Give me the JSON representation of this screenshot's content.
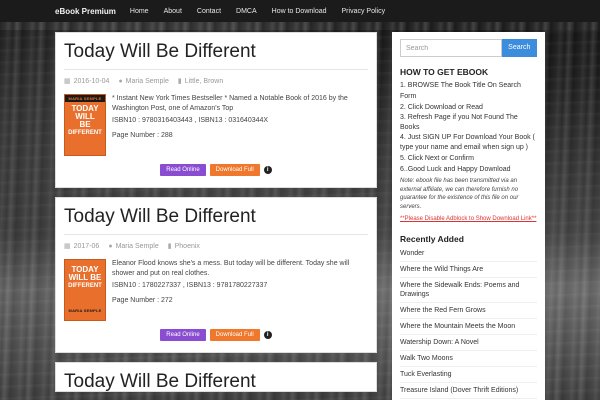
{
  "nav": {
    "brand": "eBook Premium",
    "items": [
      "Home",
      "About",
      "Contact",
      "DMCA",
      "How to Download",
      "Privacy Policy"
    ]
  },
  "posts": [
    {
      "title": "Today Will Be Different",
      "date": "2016-10-04",
      "author": "Maria Semple",
      "publisher": "Little, Brown",
      "cover": {
        "author": "MARIA SEMPLE",
        "title_lines": [
          "TODAY",
          "WILL",
          "BE",
          "DIFFERENT"
        ]
      },
      "description": "* Instant New York Times Bestseller * Named a Notable Book of 2016 by the Washington Post, one of Amazon's Top",
      "isbn": "ISBN10 : 9780316403443 , ISBN13 : 031640344X",
      "pages": "Page Number : 288",
      "read_label": "Read Online",
      "download_label": "Download Full"
    },
    {
      "title": "Today Will Be Different",
      "date": "2017-06",
      "author": "Maria Semple",
      "publisher": "Phoenix",
      "cover": {
        "author": "MARIA SEMPLE",
        "title_lines": [
          "TODAY",
          "WILL BE",
          "DIFFERENT"
        ]
      },
      "description": "Eleanor Flood knows she's a mess. But today will be different. Today she will shower and put on real clothes.",
      "isbn": "ISBN10 : 1780227337 , ISBN13 : 9781780227337",
      "pages": "Page Number : 272",
      "read_label": "Read Online",
      "download_label": "Download Full"
    },
    {
      "title": "Today Will Be Different"
    }
  ],
  "sidebar": {
    "search_placeholder": "Search",
    "search_button": "Search",
    "howto_title": "HOW TO GET EBOOK",
    "howto_steps": [
      "1. BROWSE The Book Title On Search Form",
      "2. Click Download or Read",
      "3. Refresh Page if you Not Found The Books",
      "4. Just SIGN UP For Download Your Book ( type your name and email when sign up )",
      "5. Click Next or Confirm",
      "6..Good Luck and Happy Download"
    ],
    "note": "Note: ebook file has been transmitted via an external affiliate, we can therefore furnish no guarantee for the existence of this file on our servers.",
    "adblock": "**Please Disable Adblock to Show Download Link**",
    "recent_title": "Recently Added",
    "recent": [
      "Wonder",
      "Where the Wild Things Are",
      "Where the Sidewalk Ends: Poems and Drawings",
      "Where the Red Fern Grows",
      "Where the Mountain Meets the Moon",
      "Watership Down: A Novel",
      "Walk Two Moons",
      "Tuck Everlasting",
      "Treasure Island (Dover Thrift Editions)"
    ]
  },
  "colors": {
    "navbar": "#1b1b1b",
    "read_button": "#8a4dd1",
    "download_button": "#f0782c",
    "search_button": "#3c8dde",
    "adblock_text": "#dd3333",
    "cover": "#e86f2c"
  },
  "icons": [
    "calendar-icon",
    "user-icon",
    "book-icon",
    "info-icon"
  ]
}
